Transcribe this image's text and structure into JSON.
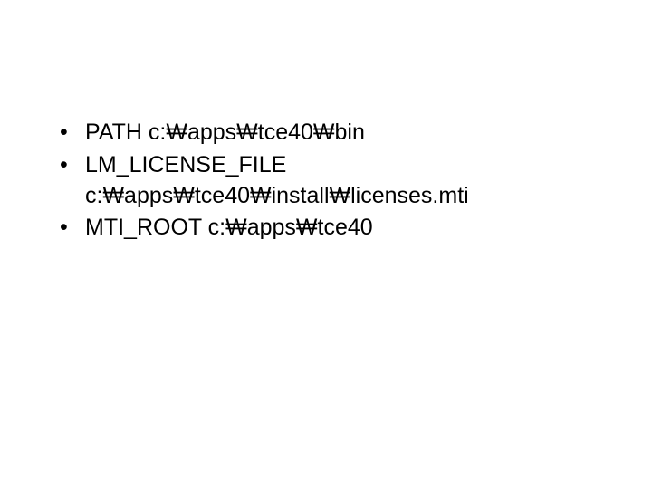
{
  "env": {
    "items": [
      {
        "name": "PATH",
        "value": "c:\\apps\\tce40\\bin",
        "value_on_newline": false
      },
      {
        "name": "LM_LICENSE_FILE",
        "value": "c:\\apps\\tce40\\install\\licenses.mti",
        "value_on_newline": true
      },
      {
        "name": "MTI_ROOT",
        "value": "c:\\apps\\tce40",
        "value_on_newline": false
      }
    ]
  }
}
